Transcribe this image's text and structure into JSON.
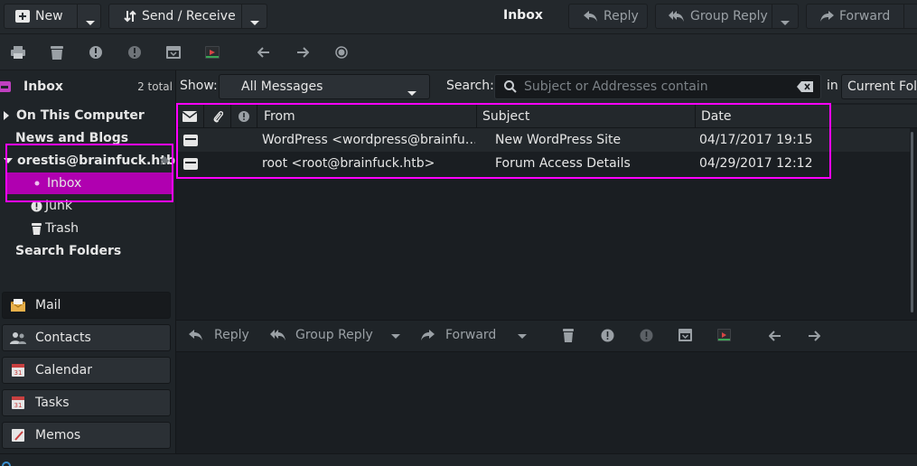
{
  "header": {
    "new_label": "New",
    "send_receive_label": "Send / Receive",
    "title": "Inbox",
    "reply_label": "Reply",
    "group_reply_label": "Group Reply",
    "forward_label": "Forward"
  },
  "toolbar": {
    "icons": [
      "print-icon",
      "delete-icon",
      "junk-icon",
      "not-junk-icon",
      "archive-icon",
      "move-icon",
      "back-arrow-icon",
      "forward-arrow-icon",
      "stop-icon"
    ]
  },
  "sidebar": {
    "folder_title": "Inbox",
    "folder_count": "2 total",
    "tree": {
      "on_this_computer": "On This Computer",
      "news_and_blogs": "News and Blogs",
      "account": "orestis@brainfuck.htb",
      "inbox": "Inbox",
      "junk": "Junk",
      "trash": "Trash",
      "search_folders": "Search Folders"
    },
    "nav": {
      "mail": "Mail",
      "contacts": "Contacts",
      "calendar": "Calendar",
      "tasks": "Tasks",
      "memos": "Memos"
    }
  },
  "filter": {
    "show_label": "Show:",
    "show_value": "All Messages",
    "search_label": "Search:",
    "search_placeholder": "Subject or Addresses contain",
    "in_label": "in",
    "scope_value": "Current Folder"
  },
  "message_list": {
    "columns": {
      "from": "From",
      "subject": "Subject",
      "date": "Date"
    },
    "rows": [
      {
        "from": "WordPress <wordpress@brainfu…",
        "subject": "New WordPress Site",
        "date": "04/17/2017 19:15"
      },
      {
        "from": "root <root@brainfuck.htb>",
        "subject": "Forum Access Details",
        "date": "04/29/2017 12:12"
      }
    ]
  },
  "preview_toolbar": {
    "reply_label": "Reply",
    "group_reply_label": "Group Reply",
    "forward_label": "Forward"
  },
  "colors": {
    "highlight_magenta": "#ff00ff",
    "selection": "#b000b0",
    "background": "#1f2428"
  }
}
